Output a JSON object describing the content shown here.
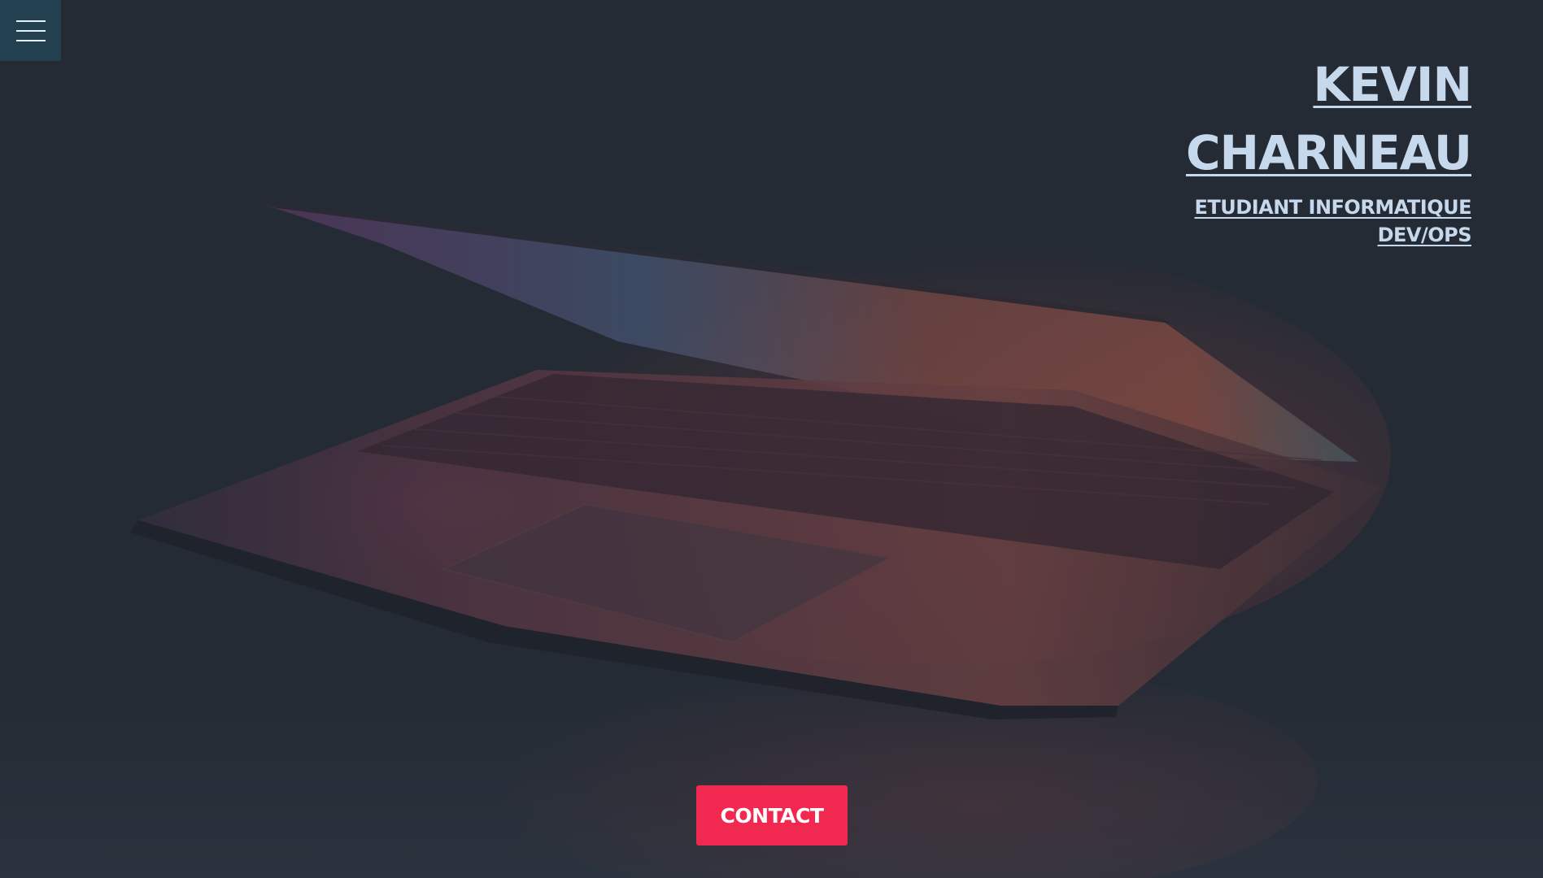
{
  "header": {
    "menu_icon": "hamburger-menu-icon"
  },
  "identity": {
    "first_name": "KEVIN",
    "last_name": "CHARNEAU",
    "role_1": "ETUDIANT INFORMATIQUE",
    "role_2": "DEV/OPS"
  },
  "cta": {
    "contact_label": "CONTACT"
  },
  "colors": {
    "background": "#252b35",
    "menu_bg": "#22404f",
    "title_text": "#c6d8ec",
    "accent": "#f1284f"
  }
}
